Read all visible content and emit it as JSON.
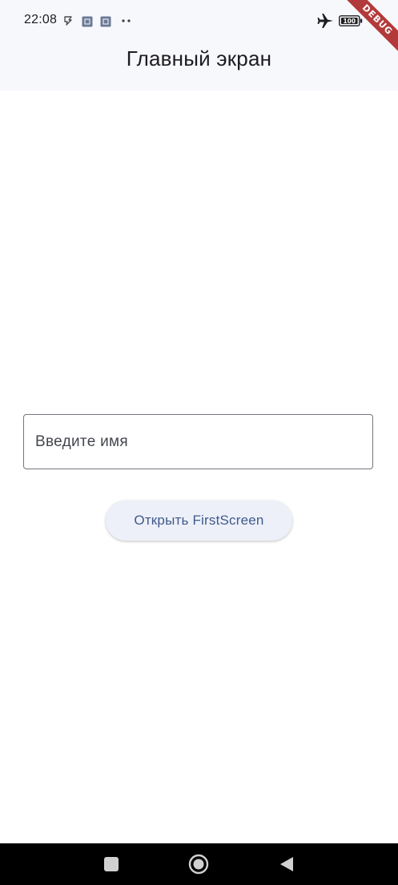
{
  "status_bar": {
    "time": "22:08",
    "icons": [
      "usb-icon",
      "notification-icon",
      "notification-icon",
      "more-dots-icon",
      "airplane-mode-icon",
      "battery-icon"
    ],
    "battery_level": "100"
  },
  "debug_banner": {
    "label": "DEBUG"
  },
  "app_bar": {
    "title": "Главный экран"
  },
  "name_input": {
    "placeholder": "Введите имя",
    "value": ""
  },
  "open_button": {
    "label": "Открыть FirstScreen"
  },
  "nav_bar": {
    "buttons": [
      "recents-square-icon",
      "home-circle-icon",
      "back-triangle-icon"
    ]
  },
  "colors": {
    "app_bar_background": "#f7f8fc",
    "button_background": "#eef0f9",
    "button_text": "#3e5a8c",
    "field_border": "#74777f",
    "debug_ribbon": "#b33a3a",
    "nav_bar_background": "#000000"
  }
}
